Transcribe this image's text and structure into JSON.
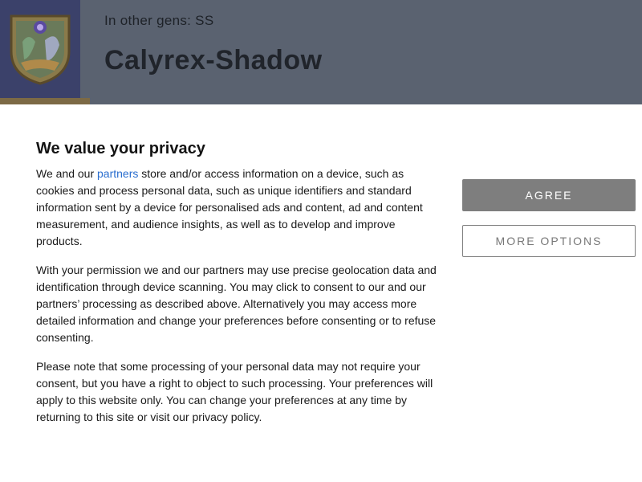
{
  "header": {
    "other_gens": "In other gens: SS",
    "title": "Calyrex-Shadow",
    "logo_icon": "crest-logo-icon"
  },
  "consent": {
    "title": "We value your privacy",
    "p1_before_link": "We and our ",
    "p1_link": "partners",
    "p1_after_link": " store and/or access information on a device, such as cookies and process personal data, such as unique identifiers and standard information sent by a device for personalised ads and content, ad and content measurement, and audience insights, as well as to develop and improve products.",
    "p2": "With your permission we and our partners may use precise geolocation data and identification through device scanning. You may click to consent to our and our partners’ processing as described above. Alternatively you may access more detailed information and change your preferences before consenting or to refuse consenting.",
    "p3": "Please note that some processing of your personal data may not require your consent, but you have a right to object to such processing. Your preferences will apply to this website only. You can change your preferences at any time by returning to this site or visit our privacy policy.",
    "agree_label": "AGREE",
    "more_options_label": "MORE OPTIONS"
  },
  "colors": {
    "header_bg": "#5a6270",
    "logo_bg": "#3b416a",
    "link": "#2a6ecf",
    "agree_bg": "#7e7e7e"
  }
}
